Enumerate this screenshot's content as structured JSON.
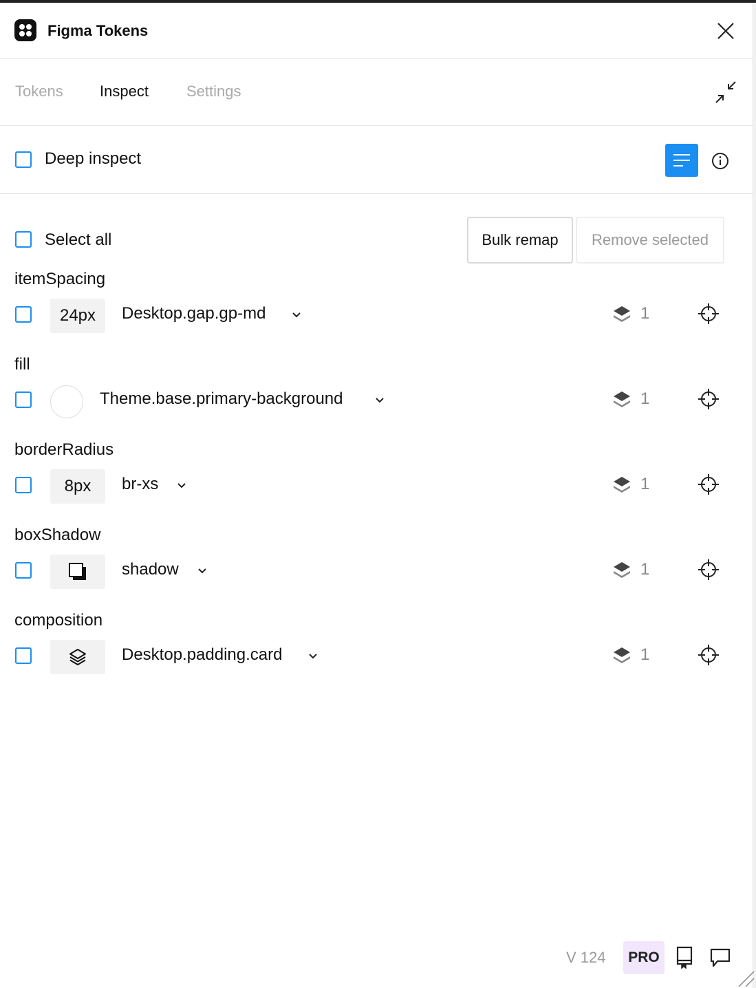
{
  "app": {
    "title": "Figma Tokens"
  },
  "tabs": [
    {
      "label": "Tokens",
      "active": false
    },
    {
      "label": "Inspect",
      "active": true
    },
    {
      "label": "Settings",
      "active": false
    }
  ],
  "deep_inspect": {
    "label": "Deep inspect",
    "checked": false
  },
  "select_all": {
    "label": "Select all",
    "checked": false
  },
  "actions": {
    "bulk_remap": "Bulk remap",
    "remove_selected": "Remove selected"
  },
  "groups": [
    {
      "title": "itemSpacing",
      "token": {
        "preview": "24px",
        "preview_type": "text",
        "name": "Desktop.gap.gp-md",
        "count": "1"
      }
    },
    {
      "title": "fill",
      "token": {
        "preview": "",
        "preview_type": "color",
        "color": "#ffffff",
        "name": "Theme.base.primary-background",
        "count": "1"
      }
    },
    {
      "title": "borderRadius",
      "token": {
        "preview": "8px",
        "preview_type": "text",
        "name": "br-xs",
        "count": "1"
      }
    },
    {
      "title": "boxShadow",
      "token": {
        "preview": "",
        "preview_type": "shadow-icon",
        "name": "shadow",
        "count": "1"
      }
    },
    {
      "title": "composition",
      "token": {
        "preview": "",
        "preview_type": "layers-icon",
        "name": "Desktop.padding.card",
        "count": "1"
      }
    }
  ],
  "footer": {
    "version": "V 124",
    "badge": "PRO"
  },
  "colors": {
    "accent": "#1b8ef2",
    "pro_bg": "#f1e6fb",
    "muted": "#aaaaaa"
  },
  "icons": [
    "app-logo-icon",
    "close-icon",
    "minimize-icon",
    "list-view-icon",
    "info-icon",
    "chevron-down-icon",
    "layers-icon",
    "target-icon",
    "shadow-icon",
    "docs-icon",
    "feedback-icon",
    "resize-icon"
  ]
}
